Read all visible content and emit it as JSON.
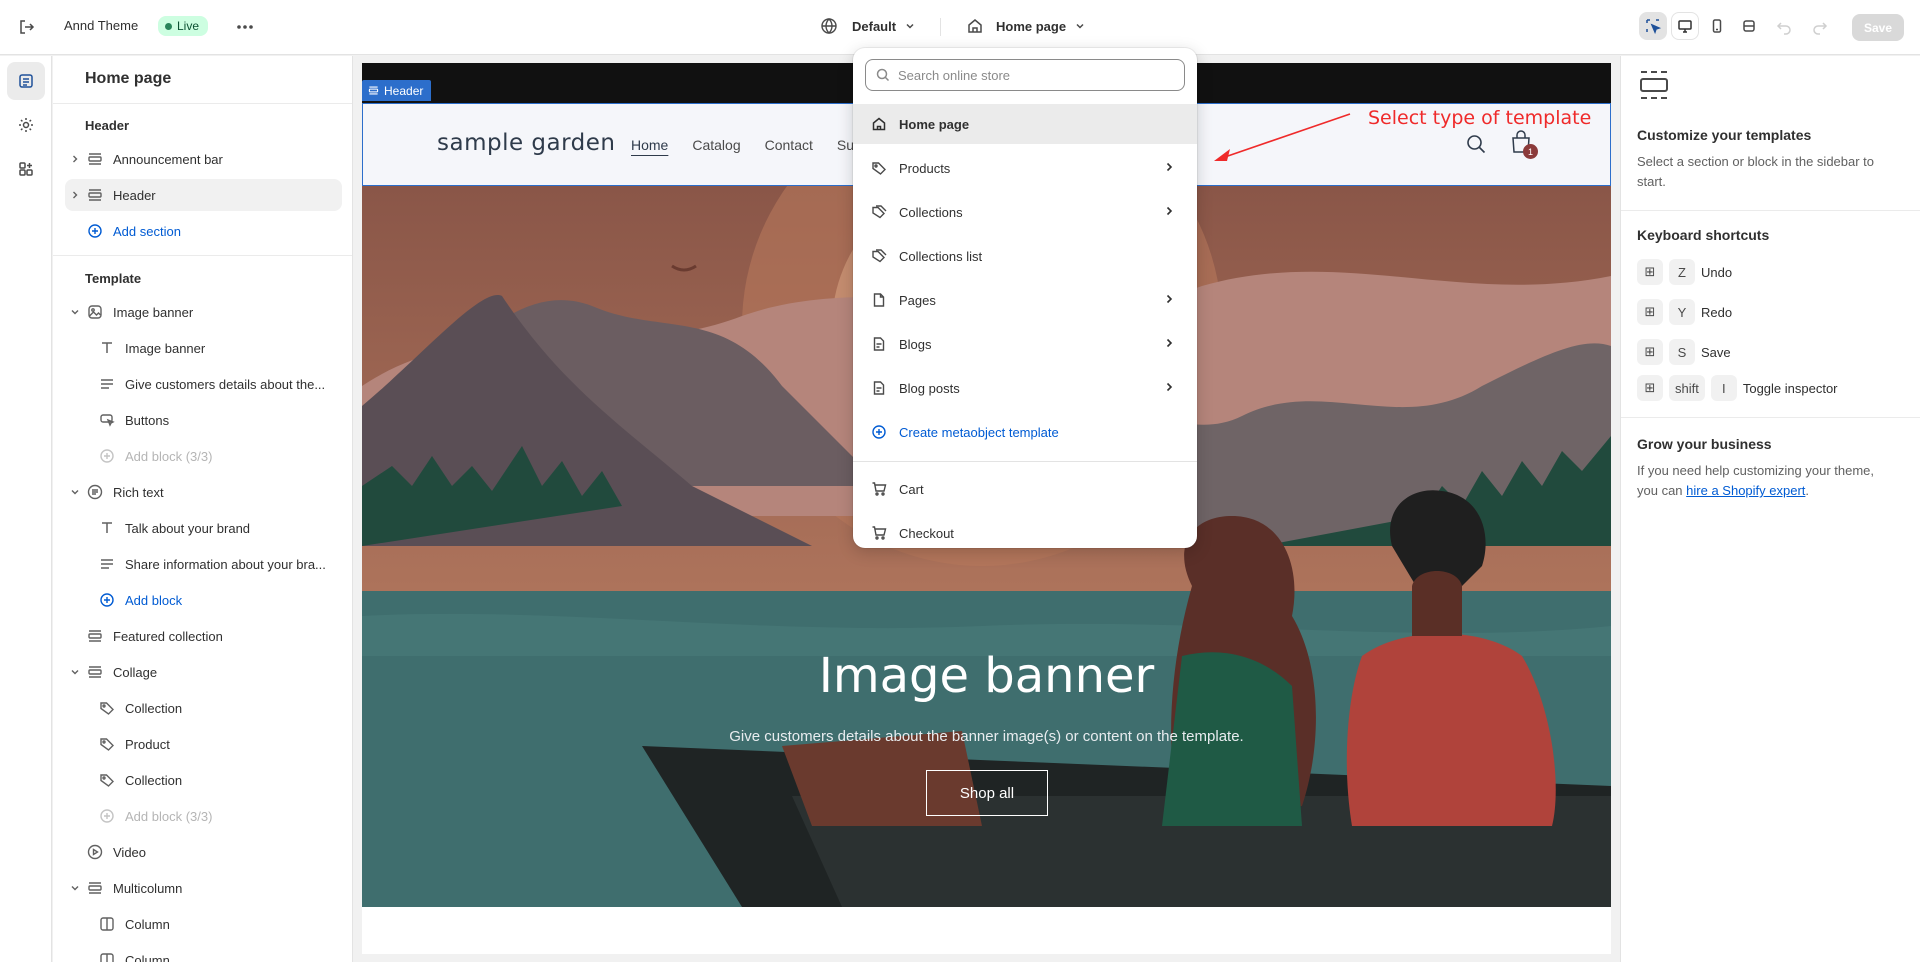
{
  "topbar": {
    "theme_name": "Annd Theme",
    "live_label": "Live",
    "default_label": "Default",
    "page_label": "Home page",
    "save_label": "Save"
  },
  "sidebar": {
    "title": "Home page",
    "header_heading": "Header",
    "header_items": [
      "Announcement bar",
      "Header"
    ],
    "add_section_label": "Add section",
    "template_heading": "Template",
    "items": [
      {
        "label": "Image banner"
      },
      {
        "label": "Image banner"
      },
      {
        "label": "Give customers details about the..."
      },
      {
        "label": "Buttons"
      },
      {
        "label": "Add block (3/3)"
      },
      {
        "label": "Rich text"
      },
      {
        "label": "Talk about your brand"
      },
      {
        "label": "Share information about your bra..."
      },
      {
        "label": "Add block"
      },
      {
        "label": "Featured collection"
      },
      {
        "label": "Collage"
      },
      {
        "label": "Collection"
      },
      {
        "label": "Product"
      },
      {
        "label": "Collection"
      },
      {
        "label": "Add block (3/3)"
      },
      {
        "label": "Video"
      },
      {
        "label": "Multicolumn"
      },
      {
        "label": "Column"
      },
      {
        "label": "Column"
      }
    ]
  },
  "dropdown": {
    "search_placeholder": "Search online store",
    "items": [
      {
        "label": "Home page",
        "icon": "home-icon"
      },
      {
        "label": "Products",
        "icon": "tag-icon"
      },
      {
        "label": "Collections",
        "icon": "collections-icon"
      },
      {
        "label": "Collections list",
        "icon": "collections-icon"
      },
      {
        "label": "Pages",
        "icon": "page-icon"
      },
      {
        "label": "Blogs",
        "icon": "blog-icon"
      },
      {
        "label": "Blog posts",
        "icon": "blog-icon"
      },
      {
        "label": "Create metaobject template",
        "icon": "plus-circle-icon"
      },
      {
        "label": "Cart",
        "icon": "cart-icon"
      },
      {
        "label": "Checkout",
        "icon": "cart-icon"
      }
    ]
  },
  "preview": {
    "header_tag": "Header",
    "store_name": "sample garden",
    "nav": [
      "Home",
      "Catalog",
      "Contact",
      "Su"
    ],
    "cart_count": "1",
    "annotation": "Select type of template",
    "banner_title": "Image banner",
    "banner_subtitle": "Give customers details about the banner image(s) or content on the template.",
    "banner_button": "Shop all"
  },
  "right_panel": {
    "customize_title": "Customize your templates",
    "customize_text": "Select a section or block in the sidebar to start.",
    "shortcuts_title": "Keyboard shortcuts",
    "shortcuts": [
      {
        "keys": [
          "Z"
        ],
        "label": "Undo"
      },
      {
        "keys": [
          "Y"
        ],
        "label": "Redo"
      },
      {
        "keys": [
          "S"
        ],
        "label": "Save"
      },
      {
        "keys": [
          "shift",
          "I"
        ],
        "label": "Toggle inspector"
      }
    ],
    "grow_title": "Grow your business",
    "grow_text": "If you need help customizing your theme, you can",
    "grow_link": "hire a Shopify expert",
    "grow_end": "."
  },
  "colors": {
    "accent": "#005bd3",
    "selection": "#2c6ecb",
    "live_bg": "#cdfee1",
    "annotation": "#ef2a2a"
  }
}
